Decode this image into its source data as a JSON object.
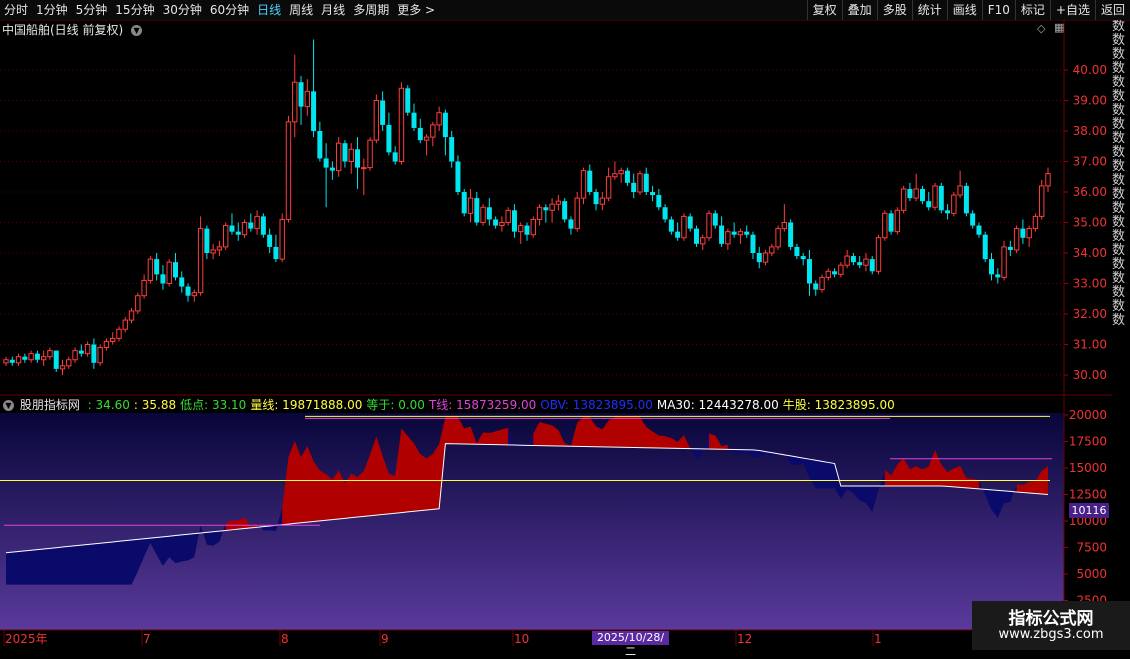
{
  "toolbar": {
    "tabs": [
      "分时",
      "1分钟",
      "5分钟",
      "15分钟",
      "30分钟",
      "60分钟",
      "日线",
      "周线",
      "月线",
      "多周期",
      "更多 >"
    ],
    "active_tab": "日线",
    "right_buttons": [
      "复权",
      "叠加",
      "多股",
      "统计",
      "画线",
      "F10",
      "标记",
      "+自选",
      "返回"
    ]
  },
  "stock": {
    "title": "中国船舶(日线 前复权)"
  },
  "main_chart": {
    "y_ticks": [
      "40.00",
      "39.00",
      "38.00",
      "37.00",
      "36.00",
      "35.00",
      "34.00",
      "33.00",
      "32.00",
      "31.00",
      "30.00"
    ],
    "ohlc": [
      [
        30.4,
        30.6,
        30.3,
        30.5
      ],
      [
        30.5,
        30.6,
        30.3,
        30.4
      ],
      [
        30.4,
        30.7,
        30.3,
        30.6
      ],
      [
        30.6,
        30.7,
        30.4,
        30.5
      ],
      [
        30.5,
        30.8,
        30.4,
        30.7
      ],
      [
        30.7,
        30.8,
        30.4,
        30.5
      ],
      [
        30.5,
        30.8,
        30.3,
        30.6
      ],
      [
        30.6,
        30.9,
        30.5,
        30.8
      ],
      [
        30.8,
        30.8,
        30.1,
        30.2
      ],
      [
        30.2,
        30.5,
        30.0,
        30.3
      ],
      [
        30.3,
        30.6,
        30.2,
        30.5
      ],
      [
        30.5,
        30.9,
        30.4,
        30.8
      ],
      [
        30.8,
        31.0,
        30.6,
        30.7
      ],
      [
        30.7,
        31.1,
        30.6,
        31.0
      ],
      [
        31.0,
        31.2,
        30.2,
        30.4
      ],
      [
        30.4,
        31.0,
        30.3,
        30.9
      ],
      [
        30.9,
        31.2,
        30.8,
        31.1
      ],
      [
        31.1,
        31.4,
        31.0,
        31.2
      ],
      [
        31.2,
        31.6,
        31.1,
        31.5
      ],
      [
        31.5,
        31.9,
        31.4,
        31.8
      ],
      [
        31.8,
        32.2,
        31.7,
        32.1
      ],
      [
        32.1,
        32.7,
        32.0,
        32.6
      ],
      [
        32.6,
        33.3,
        32.5,
        33.1
      ],
      [
        33.1,
        33.9,
        33.0,
        33.8
      ],
      [
        33.8,
        34.0,
        33.1,
        33.3
      ],
      [
        33.3,
        33.6,
        32.8,
        33.0
      ],
      [
        33.0,
        33.8,
        32.9,
        33.7
      ],
      [
        33.7,
        34.0,
        33.1,
        33.2
      ],
      [
        33.2,
        33.4,
        32.7,
        32.9
      ],
      [
        32.9,
        33.0,
        32.4,
        32.6
      ],
      [
        32.6,
        32.8,
        32.4,
        32.7
      ],
      [
        32.7,
        35.2,
        32.6,
        34.8
      ],
      [
        34.8,
        34.9,
        33.8,
        34.0
      ],
      [
        34.0,
        34.3,
        33.8,
        34.1
      ],
      [
        34.1,
        34.4,
        33.9,
        34.2
      ],
      [
        34.2,
        35.0,
        34.1,
        34.9
      ],
      [
        34.9,
        35.3,
        34.6,
        34.7
      ],
      [
        34.7,
        35.0,
        34.4,
        34.6
      ],
      [
        34.6,
        35.1,
        34.5,
        35.0
      ],
      [
        35.0,
        35.3,
        34.7,
        34.8
      ],
      [
        34.8,
        35.4,
        34.6,
        35.2
      ],
      [
        35.2,
        35.3,
        34.5,
        34.6
      ],
      [
        34.6,
        34.8,
        34.0,
        34.2
      ],
      [
        34.2,
        34.6,
        33.7,
        33.8
      ],
      [
        33.8,
        35.3,
        33.7,
        35.1
      ],
      [
        35.1,
        38.5,
        35.0,
        38.3
      ],
      [
        38.3,
        40.5,
        37.8,
        39.6
      ],
      [
        39.6,
        39.8,
        38.2,
        38.8
      ],
      [
        38.8,
        39.7,
        38.5,
        39.3
      ],
      [
        39.3,
        41.0,
        37.8,
        38.0
      ],
      [
        38.0,
        38.3,
        37.0,
        37.1
      ],
      [
        37.1,
        37.6,
        35.5,
        36.8
      ],
      [
        36.8,
        37.0,
        36.4,
        36.7
      ],
      [
        36.7,
        37.8,
        36.5,
        37.6
      ],
      [
        37.6,
        37.7,
        36.8,
        37.0
      ],
      [
        37.0,
        37.6,
        36.6,
        37.4
      ],
      [
        37.4,
        37.8,
        36.1,
        36.8
      ],
      [
        36.8,
        37.1,
        35.9,
        36.8
      ],
      [
        36.8,
        37.8,
        36.7,
        37.7
      ],
      [
        37.7,
        39.2,
        37.6,
        39.0
      ],
      [
        39.0,
        39.3,
        38.0,
        38.2
      ],
      [
        38.2,
        38.6,
        37.2,
        37.3
      ],
      [
        37.3,
        37.5,
        36.9,
        37.0
      ],
      [
        37.0,
        39.6,
        36.9,
        39.4
      ],
      [
        39.4,
        39.5,
        38.5,
        38.6
      ],
      [
        38.6,
        38.9,
        38.0,
        38.1
      ],
      [
        38.1,
        38.4,
        37.6,
        37.7
      ],
      [
        37.7,
        37.9,
        37.2,
        37.8
      ],
      [
        37.8,
        38.3,
        37.5,
        38.2
      ],
      [
        38.2,
        38.8,
        38.0,
        38.6
      ],
      [
        38.6,
        38.7,
        37.2,
        37.8
      ],
      [
        37.8,
        38.0,
        36.8,
        37.0
      ],
      [
        37.0,
        37.2,
        35.9,
        36.0
      ],
      [
        36.0,
        36.1,
        35.2,
        35.3
      ],
      [
        35.3,
        36.1,
        35.0,
        35.8
      ],
      [
        35.8,
        36.0,
        34.9,
        35.0
      ],
      [
        35.0,
        35.6,
        34.9,
        35.5
      ],
      [
        35.5,
        35.8,
        34.9,
        35.1
      ],
      [
        35.1,
        35.2,
        34.8,
        34.9
      ],
      [
        34.9,
        35.2,
        34.7,
        35.0
      ],
      [
        35.0,
        35.5,
        34.9,
        35.4
      ],
      [
        35.4,
        35.6,
        34.5,
        34.7
      ],
      [
        34.7,
        35.0,
        34.3,
        34.9
      ],
      [
        34.9,
        35.0,
        34.4,
        34.6
      ],
      [
        34.6,
        35.2,
        34.5,
        35.1
      ],
      [
        35.1,
        35.6,
        34.9,
        35.5
      ],
      [
        35.5,
        35.6,
        35.0,
        35.4
      ],
      [
        35.4,
        35.8,
        35.0,
        35.6
      ],
      [
        35.6,
        35.9,
        35.4,
        35.7
      ],
      [
        35.7,
        35.8,
        35.0,
        35.1
      ],
      [
        35.1,
        35.2,
        34.6,
        34.8
      ],
      [
        34.8,
        36.0,
        34.7,
        35.8
      ],
      [
        35.8,
        36.8,
        35.6,
        36.7
      ],
      [
        36.7,
        36.9,
        35.9,
        36.0
      ],
      [
        36.0,
        36.1,
        35.4,
        35.6
      ],
      [
        35.6,
        36.0,
        35.4,
        35.8
      ],
      [
        35.8,
        36.8,
        35.7,
        36.5
      ],
      [
        36.5,
        37.0,
        36.4,
        36.6
      ],
      [
        36.6,
        36.8,
        36.3,
        36.7
      ],
      [
        36.7,
        36.8,
        36.2,
        36.3
      ],
      [
        36.3,
        36.6,
        35.8,
        36.0
      ],
      [
        36.0,
        36.7,
        35.9,
        36.6
      ],
      [
        36.6,
        36.8,
        35.9,
        36.0
      ],
      [
        36.0,
        36.2,
        35.7,
        35.9
      ],
      [
        35.9,
        36.1,
        35.4,
        35.5
      ],
      [
        35.5,
        35.6,
        35.0,
        35.1
      ],
      [
        35.1,
        35.2,
        34.6,
        34.7
      ],
      [
        34.7,
        35.0,
        34.4,
        34.5
      ],
      [
        34.5,
        35.3,
        34.4,
        35.2
      ],
      [
        35.2,
        35.3,
        34.7,
        34.8
      ],
      [
        34.8,
        34.9,
        34.2,
        34.3
      ],
      [
        34.3,
        34.6,
        34.1,
        34.5
      ],
      [
        34.5,
        35.4,
        34.4,
        35.3
      ],
      [
        35.3,
        35.4,
        34.8,
        34.9
      ],
      [
        34.9,
        35.2,
        34.2,
        34.3
      ],
      [
        34.3,
        34.8,
        34.1,
        34.7
      ],
      [
        34.7,
        35.0,
        34.5,
        34.6
      ],
      [
        34.6,
        34.8,
        34.3,
        34.7
      ],
      [
        34.7,
        34.9,
        34.5,
        34.6
      ],
      [
        34.6,
        34.7,
        33.8,
        34.0
      ],
      [
        34.0,
        34.2,
        33.5,
        33.7
      ],
      [
        33.7,
        34.1,
        33.6,
        34.0
      ],
      [
        34.0,
        34.3,
        33.9,
        34.2
      ],
      [
        34.2,
        34.9,
        34.1,
        34.8
      ],
      [
        34.8,
        35.6,
        34.7,
        35.0
      ],
      [
        35.0,
        35.1,
        34.1,
        34.2
      ],
      [
        34.2,
        34.3,
        33.8,
        33.9
      ],
      [
        33.9,
        34.0,
        33.6,
        33.8
      ],
      [
        33.8,
        34.1,
        32.6,
        33.0
      ],
      [
        33.0,
        33.1,
        32.6,
        32.8
      ],
      [
        32.8,
        33.3,
        32.7,
        33.2
      ],
      [
        33.2,
        33.5,
        33.1,
        33.4
      ],
      [
        33.4,
        33.5,
        33.2,
        33.3
      ],
      [
        33.3,
        33.7,
        33.2,
        33.6
      ],
      [
        33.6,
        34.1,
        33.5,
        33.9
      ],
      [
        33.9,
        34.0,
        33.6,
        33.7
      ],
      [
        33.7,
        33.9,
        33.5,
        33.6
      ],
      [
        33.6,
        34.0,
        33.4,
        33.8
      ],
      [
        33.8,
        33.9,
        33.3,
        33.4
      ],
      [
        33.4,
        34.6,
        33.3,
        34.5
      ],
      [
        34.5,
        35.4,
        34.4,
        35.3
      ],
      [
        35.3,
        35.4,
        34.6,
        34.7
      ],
      [
        34.7,
        35.5,
        34.6,
        35.4
      ],
      [
        35.4,
        36.2,
        35.3,
        36.1
      ],
      [
        36.1,
        36.3,
        35.7,
        35.8
      ],
      [
        35.8,
        36.6,
        35.7,
        36.1
      ],
      [
        36.1,
        36.2,
        35.6,
        35.7
      ],
      [
        35.7,
        36.0,
        35.4,
        35.5
      ],
      [
        35.5,
        36.3,
        35.4,
        36.2
      ],
      [
        36.2,
        36.3,
        35.3,
        35.4
      ],
      [
        35.4,
        35.6,
        35.1,
        35.3
      ],
      [
        35.3,
        36.0,
        35.2,
        35.9
      ],
      [
        35.9,
        36.7,
        35.8,
        36.2
      ],
      [
        36.2,
        36.3,
        35.2,
        35.3
      ],
      [
        35.3,
        35.4,
        34.8,
        34.9
      ],
      [
        34.9,
        35.0,
        34.5,
        34.6
      ],
      [
        34.6,
        34.7,
        33.7,
        33.8
      ],
      [
        33.8,
        34.0,
        33.1,
        33.3
      ],
      [
        33.3,
        33.5,
        33.0,
        33.2
      ],
      [
        33.2,
        34.4,
        33.1,
        34.2
      ],
      [
        34.2,
        34.4,
        33.9,
        34.1
      ],
      [
        34.1,
        34.9,
        34.0,
        34.8
      ],
      [
        34.8,
        35.1,
        34.3,
        34.5
      ],
      [
        34.5,
        34.9,
        34.2,
        34.8
      ],
      [
        34.8,
        35.3,
        34.7,
        35.2
      ],
      [
        35.2,
        36.4,
        35.1,
        36.2
      ],
      [
        36.2,
        36.8,
        36.0,
        36.6
      ]
    ]
  },
  "indicator": {
    "name": "股朋指标网",
    "values": [
      {
        "text": ": 34.60",
        "color": "#33dd33"
      },
      {
        "text": ": 35.88",
        "color": "#ffff44"
      },
      {
        "text": "低点: 33.10",
        "color": "#33dd33"
      },
      {
        "text": "量线: 19871888.00",
        "color": "#ffff44"
      },
      {
        "text": "等于: 0.00",
        "color": "#33dd33"
      },
      {
        "text": "T线: 15873259.00",
        "color": "#dd44dd"
      },
      {
        "text": "OBV: 13823895.00",
        "color": "#1e2fff"
      },
      {
        "text": "MA30: 12443278.00",
        "color": "#ffffff"
      },
      {
        "text": "牛股: 13823895.00",
        "color": "#ffff44"
      }
    ],
    "y_ticks": [
      "20000",
      "17500",
      "15000",
      "12500",
      "10000",
      "7500",
      "5000",
      "2500"
    ],
    "current_tag": "10116"
  },
  "date_axis": {
    "labels": [
      "2025年",
      "7",
      "8",
      "9",
      "10",
      "12",
      "1"
    ],
    "cursor_date": "2025/10/28/二"
  },
  "right_column": [
    "数",
    "数",
    "数",
    "数",
    "数",
    "数",
    "数",
    "数",
    "数",
    "数",
    "数",
    "数",
    "数",
    "数",
    "数",
    "数",
    "数",
    "数",
    "数",
    "数",
    "数",
    "数"
  ],
  "watermark": {
    "title": "指标公式网",
    "url": "www.zbgs3.com"
  },
  "colors": {
    "up": "#ff3d3d",
    "down": "#00e5ee",
    "grid": "#5a0000",
    "accent": "#4fd2ff"
  }
}
